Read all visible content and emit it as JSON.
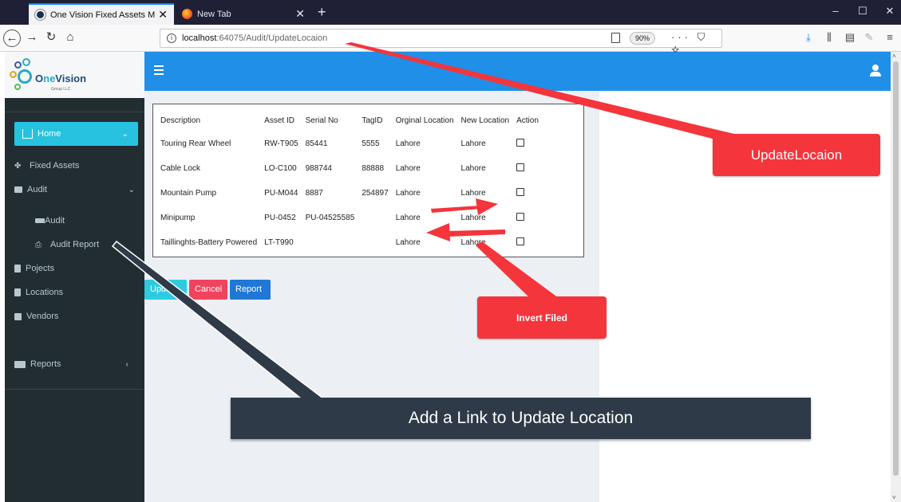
{
  "browser": {
    "tabs": [
      {
        "title": "One Vision Fixed Assets Manag",
        "active": true
      },
      {
        "title": "New Tab",
        "active": false
      }
    ],
    "url_host": "localhost",
    "url_path": ":64075/Audit/UpdateLocaion",
    "zoom": "90%"
  },
  "sidebar": {
    "logo": {
      "prefix": "O",
      "name_part1": "ne",
      "name_part2": "Vision",
      "sub": "Group LLC"
    },
    "items": [
      {
        "label": "Home"
      },
      {
        "label": "Fixed Assets"
      },
      {
        "label": "Audit"
      },
      {
        "label": "Audit"
      },
      {
        "label": "Audit Report"
      },
      {
        "label": "Pojects"
      },
      {
        "label": "Locations"
      },
      {
        "label": "Vendors"
      },
      {
        "label": "Reports"
      }
    ]
  },
  "table": {
    "headers": [
      "Description",
      "Asset ID",
      "Serial No",
      "TagID",
      "Orginal Location",
      "New Location",
      "Action"
    ],
    "rows": [
      {
        "description": "Touring Rear Wheel",
        "asset_id": "RW-T905",
        "serial_no": "85441",
        "tag_id": "5555",
        "original_location": "Lahore",
        "new_location": "Lahore",
        "checked": false
      },
      {
        "description": "Cable Lock",
        "asset_id": "LO-C100",
        "serial_no": "988744",
        "tag_id": "88888",
        "original_location": "Lahore",
        "new_location": "Lahore",
        "checked": false
      },
      {
        "description": "Mountain Pump",
        "asset_id": "PU-M044",
        "serial_no": "8887",
        "tag_id": "254897",
        "original_location": "Lahore",
        "new_location": "Lahore",
        "checked": false
      },
      {
        "description": "Minipump",
        "asset_id": "PU-0452",
        "serial_no": "PU-04525585",
        "tag_id": "",
        "original_location": "Lahore",
        "new_location": "Lahore",
        "checked": false
      },
      {
        "description": "Taillinghts-Battery Powered",
        "asset_id": "LT-T990",
        "serial_no": "",
        "tag_id": "",
        "original_location": "Lahore",
        "new_location": "Lahore",
        "checked": false
      }
    ]
  },
  "buttons": {
    "update": "Upd",
    "cancel": "Cancel",
    "report": "Report"
  },
  "annotations": {
    "update_location": "UpdateLocaion",
    "invert_field": "Invert Filed",
    "banner": "Add a Link to Update Location"
  },
  "colors": {
    "topbar": "#1f8fe8",
    "sidebar": "#222d32",
    "home_active": "#27c2e0",
    "callout": "#f4353b",
    "banner": "#2e3a47"
  }
}
